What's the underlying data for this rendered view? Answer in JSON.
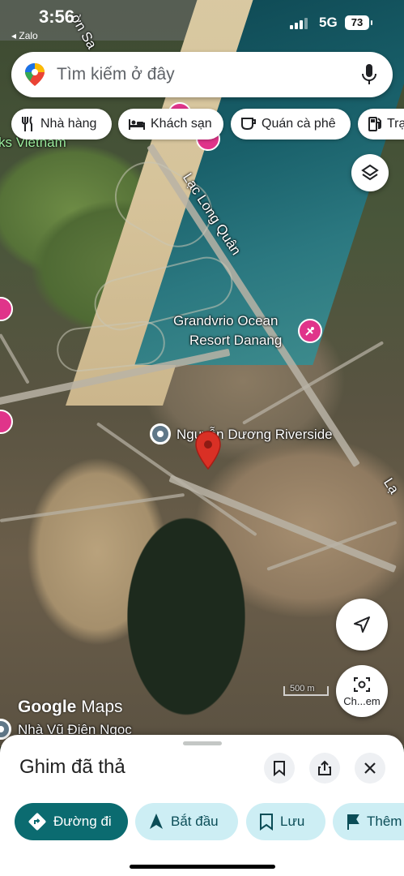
{
  "status_bar": {
    "time": "3:56",
    "back_app": "◂ Zalo",
    "network": "5G",
    "battery": "73"
  },
  "search": {
    "placeholder": "Tìm kiếm ở đây"
  },
  "chips": [
    {
      "label": "Nhà hàng",
      "icon": "restaurant-icon"
    },
    {
      "label": "Khách sạn",
      "icon": "hotel-icon"
    },
    {
      "label": "Quán cà phê",
      "icon": "coffee-icon"
    },
    {
      "label": "Trạ",
      "icon": "gas-station-icon"
    }
  ],
  "map": {
    "labels": {
      "top_partial": "ờn Sa",
      "left_partial": "ks Vietnam",
      "road": "Lạc Long Quân",
      "resort_line1": "Grandvrio Ocean",
      "resort_line2": "Resort Danang",
      "place": "Nguyễn Dương Riverside",
      "right_road_partial": "Lạ",
      "bottom_place": "Nhà Vũ Điện Ngọc",
      "scale": "500 m"
    },
    "google_logo": "Google",
    "maps_word": "Maps",
    "streetview_label": "Ch...em"
  },
  "sheet": {
    "title": "Ghim đã thả",
    "actions": [
      {
        "label": "Đường đi",
        "icon": "directions-icon",
        "style": "primary"
      },
      {
        "label": "Bắt đầu",
        "icon": "navigation-arrow-icon",
        "style": "secondary"
      },
      {
        "label": "Lưu",
        "icon": "bookmark-icon",
        "style": "secondary"
      },
      {
        "label": "Thêm",
        "icon": "flag-icon",
        "style": "secondary"
      }
    ]
  },
  "colors": {
    "primary_action": "#0b6b70",
    "secondary_action": "#cdeef4",
    "poi_pink": "#e0348a",
    "pin_red": "#d93025"
  }
}
